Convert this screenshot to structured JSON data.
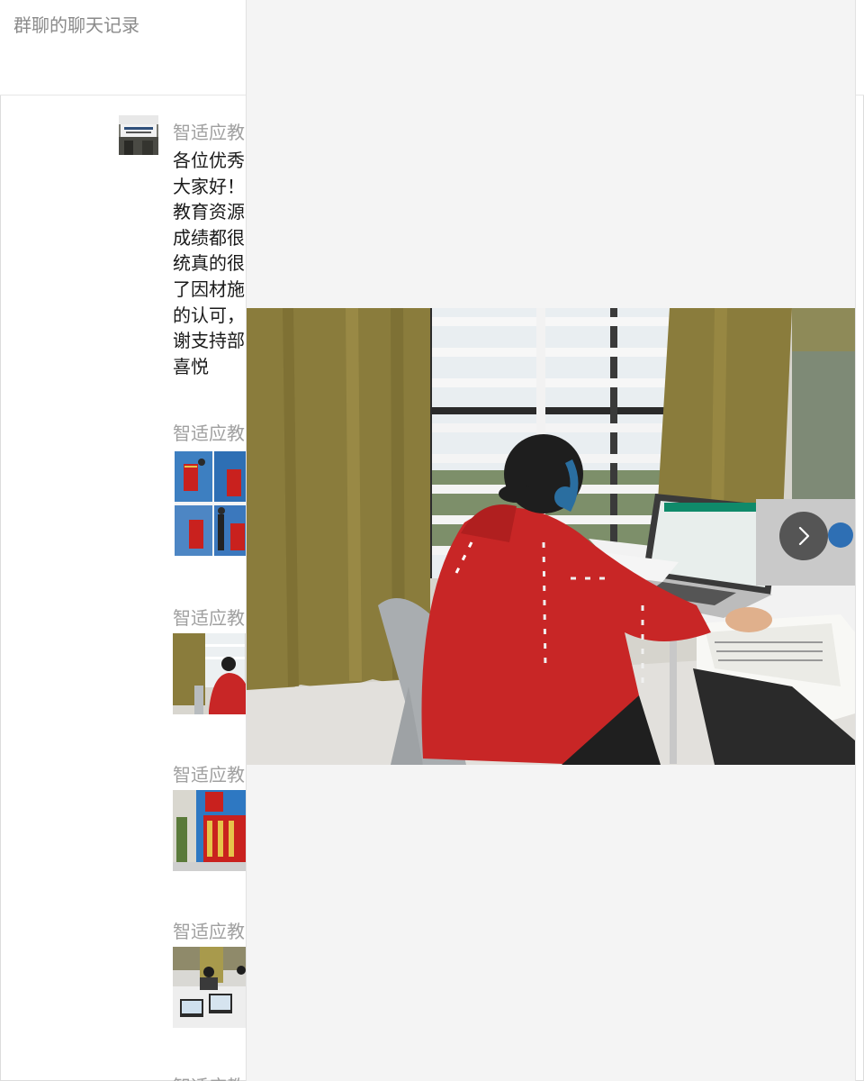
{
  "header": {
    "title": "群聊的聊天记录"
  },
  "messages": [
    {
      "sender": "智适应教",
      "lines": [
        "各位优秀",
        "大家好！",
        "教育资源",
        "成绩都很",
        "统真的很",
        "了因材施",
        "的认可，",
        "谢支持部",
        "喜悦"
      ]
    },
    {
      "sender": "智适应教",
      "image_subject": "award-banners-photo"
    },
    {
      "sender": "智适应教",
      "image_subject": "student-at-laptop-photo"
    },
    {
      "sender": "智适应教",
      "image_subject": "banner-presentation-photo"
    },
    {
      "sender": "智适应教",
      "image_subject": "classroom-laptops-photo"
    },
    {
      "sender": "智适应教"
    }
  ],
  "viewer": {
    "image_subject": "student-at-laptop-photo",
    "next_icon": "chevron-right-icon"
  },
  "colors": {
    "curtain": "#8a7c3c",
    "hoodie": "#c82626",
    "viewer_bg": "#f4f4f4"
  }
}
